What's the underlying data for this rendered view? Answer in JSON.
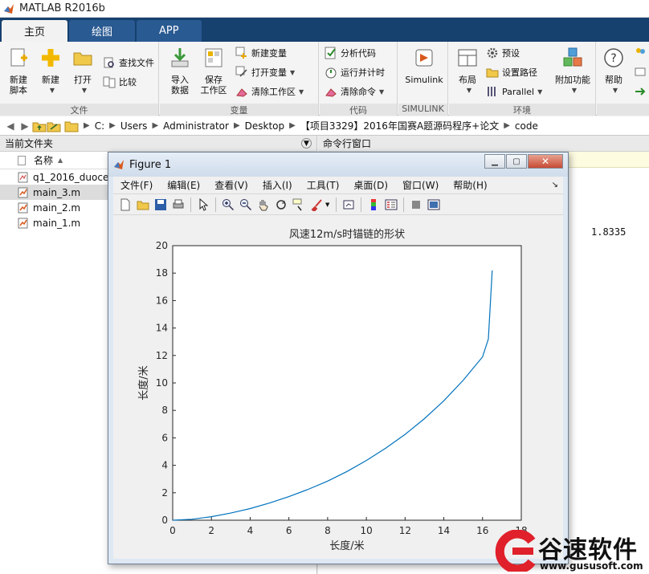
{
  "window": {
    "title": "MATLAB R2016b"
  },
  "ribbon": {
    "tabs": [
      {
        "label": "主页"
      },
      {
        "label": "绘图"
      },
      {
        "label": "APP"
      }
    ],
    "file_group": {
      "title": "文件",
      "new_script": "新建\n脚本",
      "new": "新建",
      "open": "打开",
      "find_files": "查找文件",
      "compare": "比较"
    },
    "variable_group": {
      "title": "变量",
      "import_data": "导入\n数据",
      "save_workspace": "保存\n工作区",
      "new_variable": "新建变量",
      "open_variable": "打开变量",
      "clear_workspace": "清除工作区"
    },
    "code_group": {
      "title": "代码",
      "analyze_code": "分析代码",
      "run_and_time": "运行并计时",
      "clear_commands": "清除命令"
    },
    "simulink_group": {
      "title": "SIMULINK",
      "simulink": "Simulink"
    },
    "env_group": {
      "title": "环境",
      "layout": "布局",
      "preferences": "预设",
      "set_path": "设置路径",
      "parallel": "Parallel",
      "addons": "附加功能"
    },
    "resources_group": {
      "help": "帮助"
    }
  },
  "address": {
    "crumbs": [
      "C:",
      "Users",
      "Administrator",
      "Desktop",
      "【项目3329】2016年国赛A题源码程序+论文",
      "code"
    ]
  },
  "file_browser": {
    "title": "当前文件夹",
    "column_name": "名称",
    "files": [
      {
        "name": "q1_2016_duocen",
        "type": "fig"
      },
      {
        "name": "main_3.m",
        "type": "m",
        "selected": true
      },
      {
        "name": "main_2.m",
        "type": "m"
      },
      {
        "name": "main_1.m",
        "type": "m"
      }
    ]
  },
  "command_window": {
    "title": "命令行窗口",
    "value": "1.8335"
  },
  "figure": {
    "title": "Figure 1",
    "menu": [
      "文件(F)",
      "编辑(E)",
      "查看(V)",
      "插入(I)",
      "工具(T)",
      "桌面(D)",
      "窗口(W)",
      "帮助(H)"
    ]
  },
  "chart_data": {
    "type": "line",
    "title": "风速12m/s时锚链的形状",
    "xlabel": "长度/米",
    "ylabel": "长度/米",
    "xlim": [
      0,
      18
    ],
    "ylim": [
      0,
      20
    ],
    "xticks": [
      0,
      2,
      4,
      6,
      8,
      10,
      12,
      14,
      16,
      18
    ],
    "yticks": [
      0,
      2,
      4,
      6,
      8,
      10,
      12,
      14,
      16,
      18,
      20
    ],
    "grid": false,
    "series": [
      {
        "color": "#0072bd",
        "x": [
          0,
          1,
          2,
          3,
          4,
          5,
          6,
          7,
          8,
          9,
          10,
          11,
          12,
          13,
          14,
          15,
          16,
          16.3,
          16.5
        ],
        "y": [
          0,
          0.07,
          0.26,
          0.52,
          0.85,
          1.25,
          1.72,
          2.25,
          2.85,
          3.55,
          4.35,
          5.25,
          6.25,
          7.4,
          8.7,
          10.2,
          11.9,
          13.2,
          18.2
        ]
      }
    ]
  },
  "watermark": {
    "text": "谷速软件",
    "url": "www.gususoft.com"
  }
}
